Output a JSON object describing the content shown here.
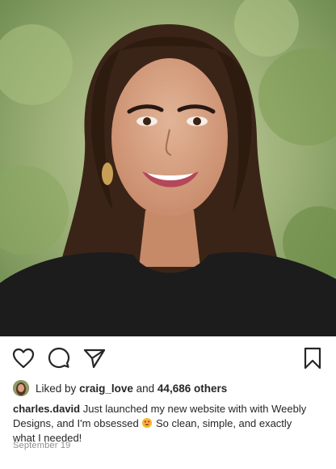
{
  "post": {
    "image_alt": "Portrait photo",
    "likes": {
      "prefix": "Liked by",
      "user": "craig_love",
      "and": "and",
      "count": "44,686 others"
    },
    "caption": {
      "username": "charles.david",
      "text_before_emoji": "Just launched my new website with with Weebly Designs, and I'm obsessed",
      "emoji": "smiling-face-with-heart-eyes",
      "text_after_emoji": "So clean, simple, and exactly what I needed!"
    },
    "date": "September 19"
  },
  "icons": {
    "like": "heart-icon",
    "comment": "comment-icon",
    "share": "send-icon",
    "save": "bookmark-icon"
  },
  "colors": {
    "text": "#262626",
    "muted": "#8e8e8e",
    "background": "#ffffff"
  }
}
